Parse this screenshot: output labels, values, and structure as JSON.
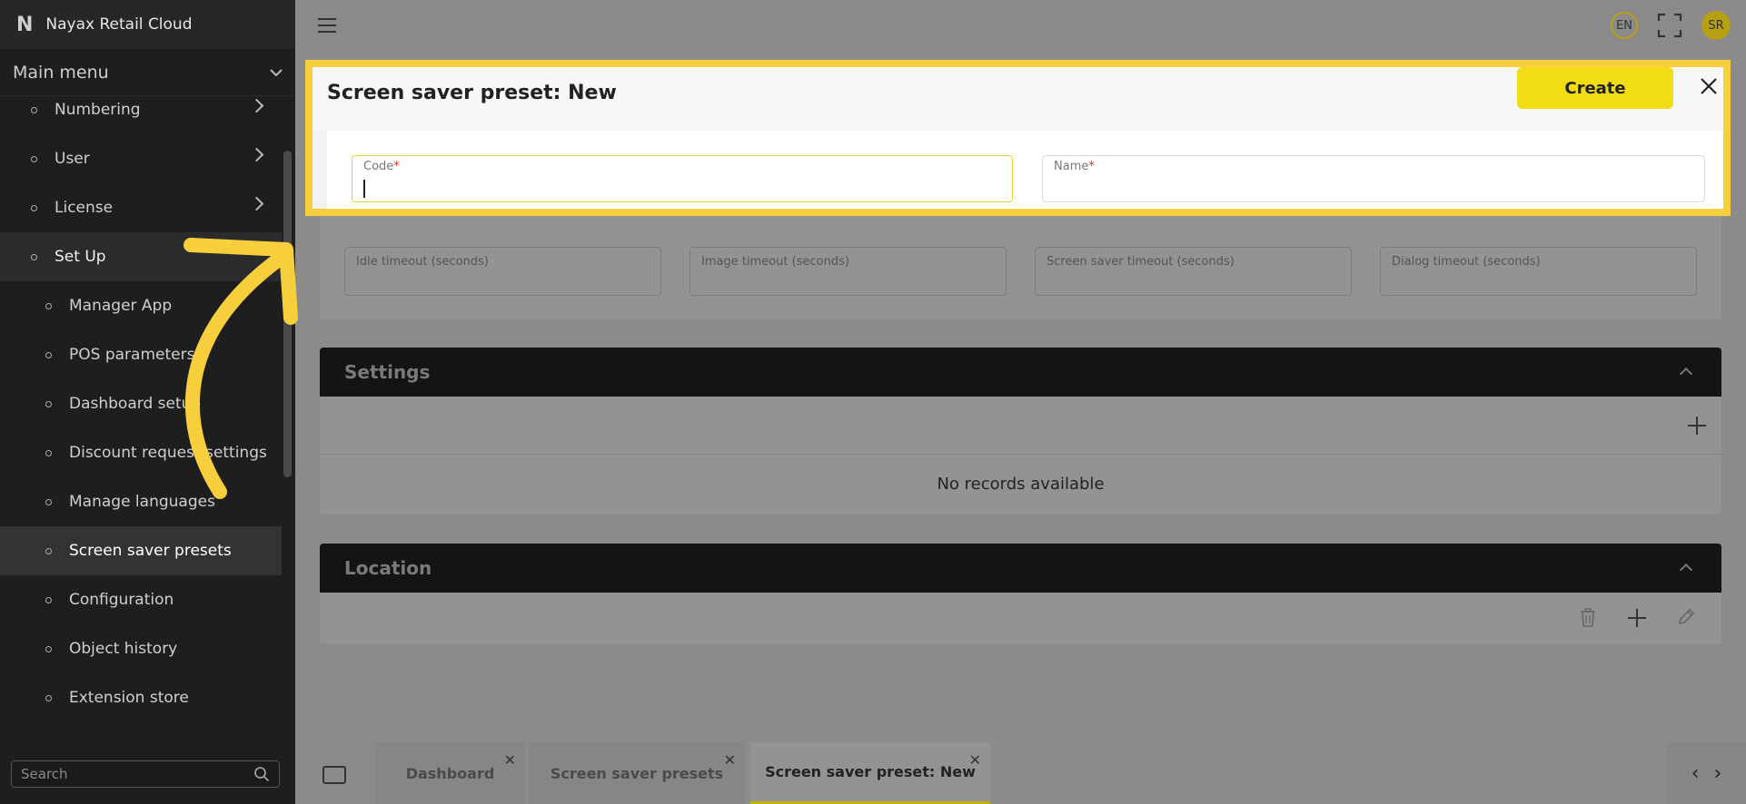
{
  "app": {
    "brand_logo": "N",
    "brand_name": "Nayax Retail Cloud"
  },
  "sidebar": {
    "main_menu_label": "Main menu",
    "items": [
      {
        "label": "Numbering",
        "level": 1,
        "has_children": true
      },
      {
        "label": "User",
        "level": 1,
        "has_children": true
      },
      {
        "label": "License",
        "level": 1,
        "has_children": true
      },
      {
        "label": "Set Up",
        "level": 1,
        "expanded": true
      },
      {
        "label": "Manager App",
        "level": 2
      },
      {
        "label": "POS parameters",
        "level": 2
      },
      {
        "label": "Dashboard setup",
        "level": 2
      },
      {
        "label": "Discount request settings",
        "level": 2
      },
      {
        "label": "Manage languages",
        "level": 2
      },
      {
        "label": "Screen saver presets",
        "level": 2,
        "active": true
      },
      {
        "label": "Configuration",
        "level": 2
      },
      {
        "label": "Object history",
        "level": 2
      },
      {
        "label": "Extension store",
        "level": 2
      }
    ],
    "search_placeholder": "Search"
  },
  "topbar": {
    "language": "EN",
    "user_initials": "SR"
  },
  "dialog": {
    "title": "Screen saver preset: New",
    "create_label": "Create",
    "fields": {
      "code_label": "Code",
      "name_label": "Name",
      "required_mark": "*"
    }
  },
  "background_form": {
    "timeouts": [
      "Idle timeout (seconds)",
      "Image timeout (seconds)",
      "Screen saver timeout (seconds)",
      "Dialog timeout (seconds)"
    ],
    "settings_title": "Settings",
    "no_records": "No records available",
    "location_title": "Location"
  },
  "tabs": [
    {
      "label": "Dashboard",
      "active": false
    },
    {
      "label": "Screen saver presets",
      "active": false
    },
    {
      "label": "Screen saver preset: New",
      "active": true
    }
  ],
  "colors": {
    "highlight": "#f7cf3d",
    "create_button": "#f2dd15",
    "sidebar_bg": "#1e1e1e",
    "section_header": "#141414"
  },
  "icons": [
    "hamburger-icon",
    "fullscreen-icon",
    "close-icon",
    "search-icon",
    "trash-icon",
    "plus-icon",
    "edit-pencil-icon",
    "windows-icon",
    "chevron-left-icon",
    "chevron-right-icon"
  ]
}
